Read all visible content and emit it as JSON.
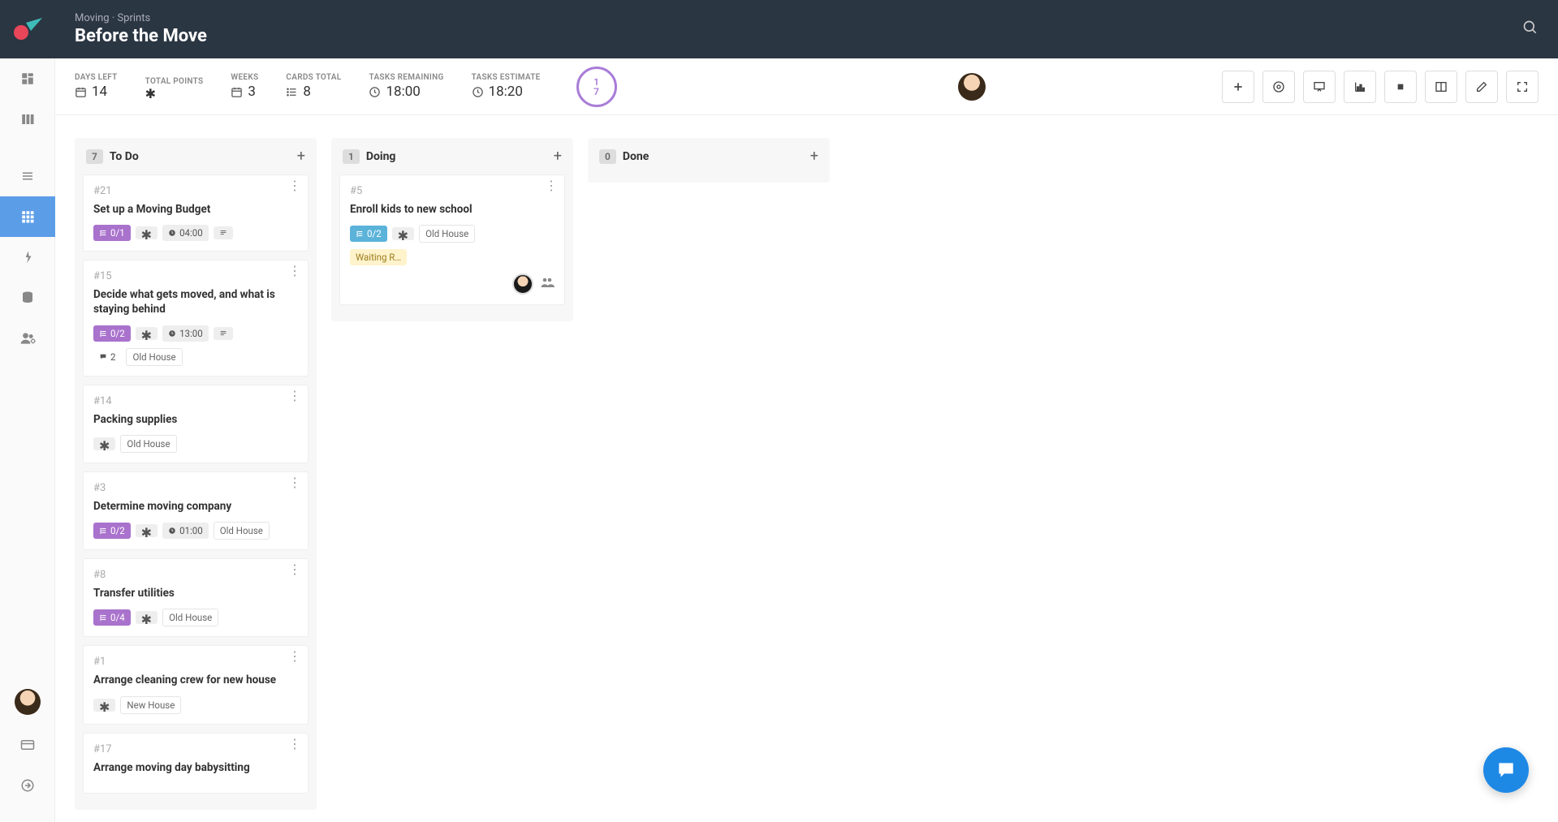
{
  "header": {
    "breadcrumb": "Moving · Sprints",
    "title": "Before the Move"
  },
  "stats": {
    "days_left": {
      "label": "DAYS LEFT",
      "value": "14"
    },
    "total_points": {
      "label": "TOTAL POINTS",
      "value": ""
    },
    "weeks": {
      "label": "WEEKS",
      "value": "3"
    },
    "cards_total": {
      "label": "CARDS TOTAL",
      "value": "8"
    },
    "tasks_remaining": {
      "label": "TASKS REMAINING",
      "value": "18:00"
    },
    "tasks_estimate": {
      "label": "TASKS ESTIMATE",
      "value": "18:20"
    },
    "circle": {
      "top": "1",
      "bottom": "7"
    }
  },
  "columns": [
    {
      "id": "todo",
      "title": "To Do",
      "count": "7",
      "cards": [
        {
          "id": "#21",
          "title": "Set up a Moving Budget",
          "progress": "0/1",
          "progress_color": "purple",
          "time": "04:00",
          "tags": [],
          "has_star": true,
          "has_desc": true
        },
        {
          "id": "#15",
          "title": "Decide what gets moved, and what is staying behind",
          "progress": "0/2",
          "progress_color": "purple",
          "time": "13:00",
          "tags": [
            "Old House"
          ],
          "has_star": true,
          "has_desc": true,
          "comments": "2"
        },
        {
          "id": "#14",
          "title": "Packing supplies",
          "tags": [
            "Old House"
          ],
          "has_star": true
        },
        {
          "id": "#3",
          "title": "Determine moving company",
          "progress": "0/2",
          "progress_color": "purple",
          "time": "01:00",
          "tags": [
            "Old House"
          ],
          "has_star": true
        },
        {
          "id": "#8",
          "title": "Transfer utilities",
          "progress": "0/4",
          "progress_color": "purple",
          "tags": [
            "Old House"
          ],
          "has_star": true
        },
        {
          "id": "#1",
          "title": "Arrange cleaning crew for new house",
          "tags": [
            "New House"
          ],
          "has_star": true
        },
        {
          "id": "#17",
          "title": "Arrange moving day babysitting"
        }
      ]
    },
    {
      "id": "doing",
      "title": "Doing",
      "count": "1",
      "cards": [
        {
          "id": "#5",
          "title": "Enroll kids to new school",
          "progress": "0/2",
          "progress_color": "blue",
          "tags": [
            "Old House"
          ],
          "has_star": true,
          "status": "Waiting R…",
          "has_avatar": true,
          "has_people": true
        }
      ]
    },
    {
      "id": "done",
      "title": "Done",
      "count": "0",
      "cards": []
    }
  ]
}
